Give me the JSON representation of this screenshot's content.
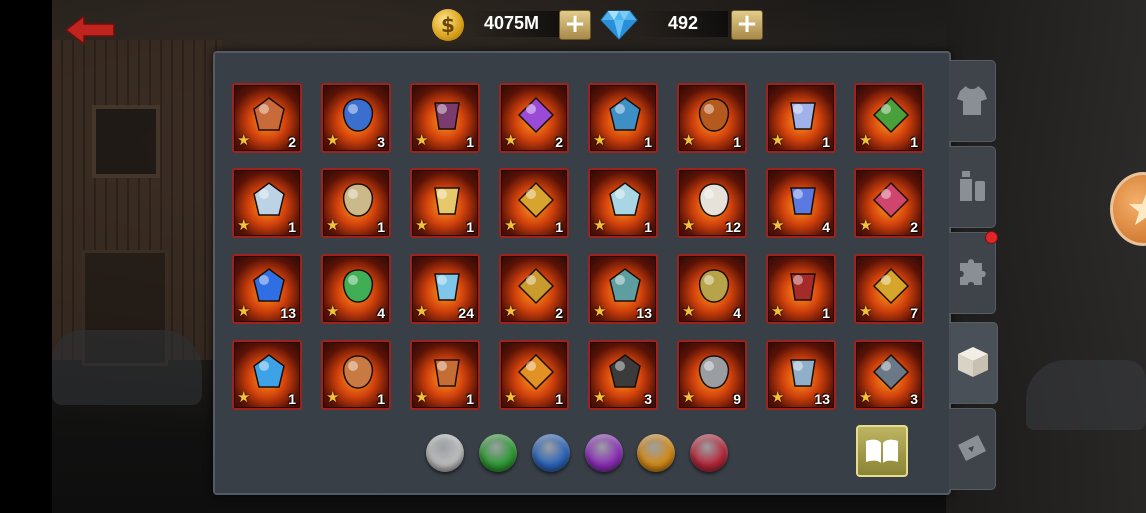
{
  "header": {
    "gold_amount": "4075M",
    "gold_icon": "coin-dollar-icon",
    "gold_icon_glyph": "$",
    "gems_amount": "492",
    "gems_icon": "diamond-icon",
    "add_label": "+"
  },
  "inventory": {
    "star_glyph": "★",
    "items": [
      {
        "name": "flaming-belt",
        "count": "2",
        "color": "#c86a3a"
      },
      {
        "name": "anchor",
        "count": "3",
        "color": "#3a6fd0"
      },
      {
        "name": "dark-flower",
        "count": "1",
        "color": "#7a3c6e"
      },
      {
        "name": "purple-amulet",
        "count": "2",
        "color": "#9b4ad8"
      },
      {
        "name": "blue-chest-armor",
        "count": "1",
        "color": "#3f8fc7"
      },
      {
        "name": "fire-armor",
        "count": "1",
        "color": "#b55a1f"
      },
      {
        "name": "ice-gauntlet",
        "count": "1",
        "color": "#9fb3ea"
      },
      {
        "name": "green-herb",
        "count": "1",
        "color": "#4aa03a"
      },
      {
        "name": "crystal-shard",
        "count": "1",
        "color": "#bcd3e6"
      },
      {
        "name": "scroll",
        "count": "1",
        "color": "#cbb98a"
      },
      {
        "name": "horn",
        "count": "1",
        "color": "#e5c96c"
      },
      {
        "name": "gold-chain",
        "count": "1",
        "color": "#d8a430"
      },
      {
        "name": "ice-block",
        "count": "1",
        "color": "#a9d6e4"
      },
      {
        "name": "feather-amulet",
        "count": "12",
        "color": "#e6e2da"
      },
      {
        "name": "blue-orb-ring",
        "count": "4",
        "color": "#5a7ae2"
      },
      {
        "name": "royal-crown",
        "count": "2",
        "color": "#d0456e"
      },
      {
        "name": "sapphire-sun",
        "count": "13",
        "color": "#2f6fe3"
      },
      {
        "name": "emerald-wings",
        "count": "4",
        "color": "#3fae54"
      },
      {
        "name": "crystal-heart",
        "count": "24",
        "color": "#7ec6ea"
      },
      {
        "name": "gold-blue-emblem",
        "count": "2",
        "color": "#c99a2c"
      },
      {
        "name": "green-plate-armor",
        "count": "13",
        "color": "#5f9ea0"
      },
      {
        "name": "gold-helmet",
        "count": "4",
        "color": "#b6a34a"
      },
      {
        "name": "demon-helmet",
        "count": "1",
        "color": "#a52a2a"
      },
      {
        "name": "gold-scepter",
        "count": "7",
        "color": "#d6a52c"
      },
      {
        "name": "water-orb",
        "count": "1",
        "color": "#3ea3e6"
      },
      {
        "name": "copper-ring-1",
        "count": "1",
        "color": "#c87a42"
      },
      {
        "name": "copper-ring-2",
        "count": "1",
        "color": "#c46e36"
      },
      {
        "name": "fire-hourglass",
        "count": "1",
        "color": "#e29224"
      },
      {
        "name": "hooded-cloak",
        "count": "3",
        "color": "#3b3b3b"
      },
      {
        "name": "knight-helmet",
        "count": "9",
        "color": "#9a9ea3"
      },
      {
        "name": "steel-claw",
        "count": "13",
        "color": "#8fb0c8"
      },
      {
        "name": "steel-gauntlet",
        "count": "3",
        "color": "#6b7887"
      }
    ]
  },
  "filters": [
    {
      "name": "filter-white",
      "color": "#bdbdbd"
    },
    {
      "name": "filter-green",
      "color": "#2e9a34"
    },
    {
      "name": "filter-blue",
      "color": "#2c64b8"
    },
    {
      "name": "filter-purple",
      "color": "#8a2fb6"
    },
    {
      "name": "filter-orange",
      "color": "#d38a17"
    },
    {
      "name": "filter-red",
      "color": "#b5283a"
    }
  ],
  "side_tabs": [
    {
      "name": "tab-equipment",
      "icon": "shirt-icon"
    },
    {
      "name": "tab-potions",
      "icon": "potion-icon"
    },
    {
      "name": "tab-puzzle",
      "icon": "puzzle-piece-icon"
    },
    {
      "name": "tab-materials",
      "icon": "box-icon",
      "active": true
    },
    {
      "name": "tab-tickets",
      "icon": "ticket-icon"
    }
  ],
  "colors": {
    "panel_bg": "#393f47",
    "slot_border": "#9e231c",
    "accent_gold": "#d7a019",
    "notification_red": "#e0262b"
  }
}
